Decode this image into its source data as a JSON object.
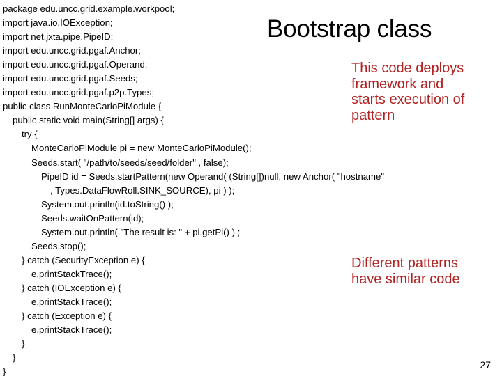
{
  "slide": {
    "title": "Bootstrap class",
    "page_number": "27",
    "accent_color": "#B12222",
    "text_color": "#000000",
    "background_color": "#FFFFFF"
  },
  "callouts": [
    {
      "id": "deploys",
      "lines": [
        "This code deploys",
        "framework and",
        "starts execution of",
        "pattern"
      ]
    },
    {
      "id": "patterns",
      "lines": [
        "Different patterns",
        "have similar code"
      ]
    }
  ],
  "code": {
    "language": "java",
    "lines": [
      {
        "indent": 0,
        "text": "package edu.uncc.grid.example.workpool;"
      },
      {
        "indent": 0,
        "text": "import java.io.IOException;"
      },
      {
        "indent": 0,
        "text": "import net.jxta.pipe.PipeID;"
      },
      {
        "indent": 0,
        "text": "import edu.uncc.grid.pgaf.Anchor;"
      },
      {
        "indent": 0,
        "text": "import edu.uncc.grid.pgaf.Operand;"
      },
      {
        "indent": 0,
        "text": "import edu.uncc.grid.pgaf.Seeds;"
      },
      {
        "indent": 0,
        "text": "import edu.uncc.grid.pgaf.p2p.Types;"
      },
      {
        "indent": 0,
        "text": "public class RunMonteCarloPiModule {"
      },
      {
        "indent": 1,
        "text": "public static void main(String[] args) {"
      },
      {
        "indent": 2,
        "text": "try {"
      },
      {
        "indent": 3,
        "text": "MonteCarloPiModule pi = new MonteCarloPiModule();"
      },
      {
        "indent": 3,
        "text": "Seeds.start( \"/path/to/seeds/seed/folder\" , false);"
      },
      {
        "indent": 4,
        "text": "PipeID id = Seeds.startPattern(new Operand( (String[])null, new Anchor( \"hostname\""
      },
      {
        "indent": 5,
        "text": ", Types.DataFlowRoll.SINK_SOURCE), pi ) );"
      },
      {
        "indent": 4,
        "text": "System.out.println(id.toString() );"
      },
      {
        "indent": 4,
        "text": "Seeds.waitOnPattern(id);"
      },
      {
        "indent": 4,
        "text": "System.out.println( \"The result is: \" + pi.getPi() ) ;"
      },
      {
        "indent": 3,
        "text": "Seeds.stop();"
      },
      {
        "indent": 2,
        "text": "} catch (SecurityException e) {"
      },
      {
        "indent": 3,
        "text": "e.printStackTrace();"
      },
      {
        "indent": 2,
        "text": "} catch (IOException e) {"
      },
      {
        "indent": 3,
        "text": "e.printStackTrace();"
      },
      {
        "indent": 2,
        "text": "} catch (Exception e) {"
      },
      {
        "indent": 3,
        "text": "e.printStackTrace();"
      },
      {
        "indent": 2,
        "text": "}"
      },
      {
        "indent": 1,
        "text": "}"
      },
      {
        "indent": 0,
        "text": "}"
      }
    ]
  }
}
